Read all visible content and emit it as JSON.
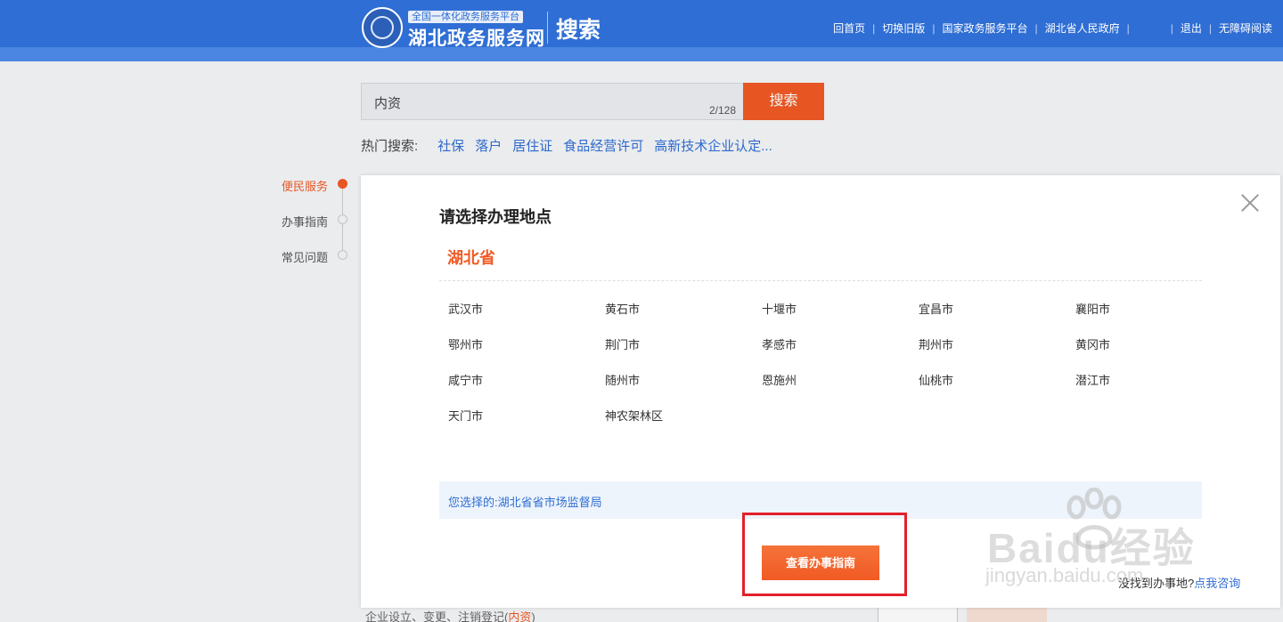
{
  "header": {
    "platform_badge": "全国一体化政务服务平台",
    "site_name": "湖北政务服务网",
    "section": "搜索",
    "nav": [
      "回首页",
      "切换旧版",
      "国家政务服务平台",
      "湖北省人民政府",
      "退出",
      "无障碍阅读"
    ]
  },
  "search": {
    "value": "内资",
    "counter": "2/128",
    "button": "搜索",
    "hot_label": "热门搜索:",
    "hot_items": [
      "社保",
      "落户",
      "居住证",
      "食品经营许可",
      "高新技术企业认定..."
    ]
  },
  "sidebar": {
    "items": [
      {
        "label": "便民服务",
        "active": true
      },
      {
        "label": "办事指南",
        "active": false
      },
      {
        "label": "常见问题",
        "active": false
      }
    ]
  },
  "background_result": {
    "text": "企业设立、变更、注销登记(",
    "highlight": "内资",
    "suffix": ")"
  },
  "modal": {
    "title": "请选择办理地点",
    "province": "湖北省",
    "cities": [
      "武汉市",
      "黄石市",
      "十堰市",
      "宜昌市",
      "襄阳市",
      "鄂州市",
      "荆门市",
      "孝感市",
      "荆州市",
      "黄冈市",
      "咸宁市",
      "随州市",
      "恩施州",
      "仙桃市",
      "潜江市",
      "天门市",
      "神农架林区"
    ],
    "selected": "您选择的:湖北省省市场监督局",
    "view_button": "查看办事指南",
    "consult_prefix": "没找到办事地?",
    "consult_link": "点我咨询"
  },
  "watermark": {
    "brand": "Baidu经验",
    "url": "jingyan.baidu.com"
  },
  "colors": {
    "primary_blue": "#2f6ed4",
    "accent_orange": "#f15a24",
    "highlight_red": "#e2202a"
  }
}
